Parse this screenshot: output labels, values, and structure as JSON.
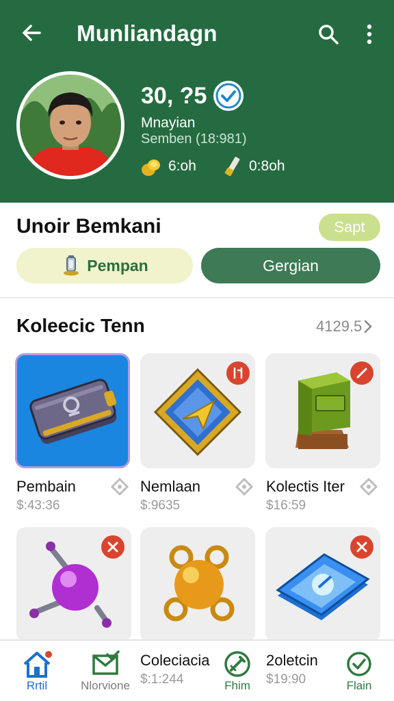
{
  "header": {
    "title": "Munliandagn",
    "score": "30, ?5",
    "user_name": "Mnayian",
    "user_sub": "Semben (18:981)",
    "stat1": "6:oh",
    "stat2": "0:8oh"
  },
  "section1": {
    "title": "Unoir Bemkani",
    "badge": "Sapt",
    "pill_left": "Pempan",
    "pill_right": "Gergian"
  },
  "collection": {
    "title": "Koleecic Tenn",
    "count": "4129.5",
    "items": [
      {
        "name": "Pembain",
        "price": "$:43:36"
      },
      {
        "name": "Nemlaan",
        "price": "$:9635"
      },
      {
        "name": "Kolectis Iter",
        "price": "$16:59"
      }
    ]
  },
  "bottom_nav": {
    "home_label": "Rrtil",
    "item2_label": "Nlorvione",
    "item3_title": "Coleciacia",
    "item3_price": "$:1:244",
    "item4_label": "Fhim",
    "item5_title": "2oletcin",
    "item5_price": "$19:90",
    "item6_label": "Flain"
  },
  "colors": {
    "header_bg": "#256b41",
    "accent_green": "#3d7a55",
    "badge_red": "#d9442e",
    "nav_blue": "#1d6fd3"
  },
  "icons": [
    "back-arrow-icon",
    "search-icon",
    "more-vert-icon",
    "verified-check-icon",
    "coins-icon",
    "potion-icon",
    "lantern-icon",
    "diamond-icon",
    "home-icon",
    "envelope-check-icon",
    "sword-icon",
    "check-circle-icon"
  ]
}
